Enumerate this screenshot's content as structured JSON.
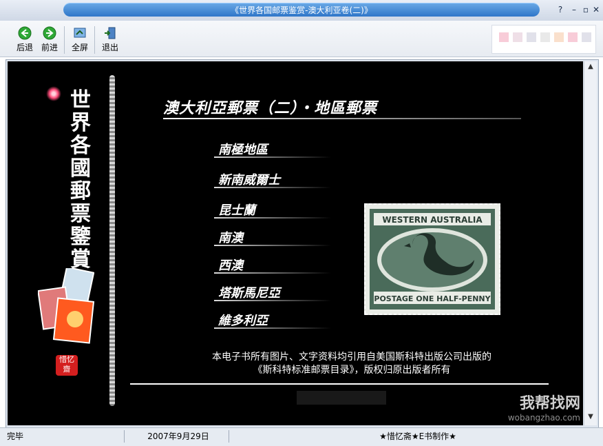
{
  "window": {
    "title": "《世界各国邮票鉴赏-澳大利亚卷(二)》"
  },
  "toolbar": {
    "back": "后退",
    "forward": "前进",
    "fullscreen": "全屏",
    "exit": "退出"
  },
  "sidebar": {
    "title_chars": [
      "世",
      "界",
      "各",
      "國",
      "郵",
      "票",
      "鑒",
      "賞"
    ],
    "seal_text": "惜忆齋"
  },
  "main": {
    "heading": "澳大利亞郵票（二）・地區郵票",
    "regions": [
      "南極地區",
      "新南威爾士",
      "昆士蘭",
      "南澳",
      "西澳",
      "塔斯馬尼亞",
      "維多利亞"
    ]
  },
  "stamp": {
    "top_text": "WESTERN AUSTRALIA",
    "bottom_text": "POSTAGE ONE HALF-PENNY",
    "color": "#4a6b5a"
  },
  "copyright": {
    "line1": "本电子书所有图片、文字资料均引用自美国斯科特出版公司出版的",
    "line2": "《斯科特标准邮票目录》，版权归原出版者所有"
  },
  "watermark": {
    "brand": "我帮找网",
    "url": "wobangzhao.com"
  },
  "statusbar": {
    "status": "完毕",
    "date": "2007年9月29日",
    "credit": "★惜忆斋★E书制作★"
  },
  "colors": {
    "background": "#000000",
    "accent": "#2f76c9"
  },
  "icons": {
    "back": "arrow-left-icon",
    "forward": "arrow-right-icon",
    "fullscreen": "fullscreen-icon",
    "exit": "exit-icon"
  }
}
